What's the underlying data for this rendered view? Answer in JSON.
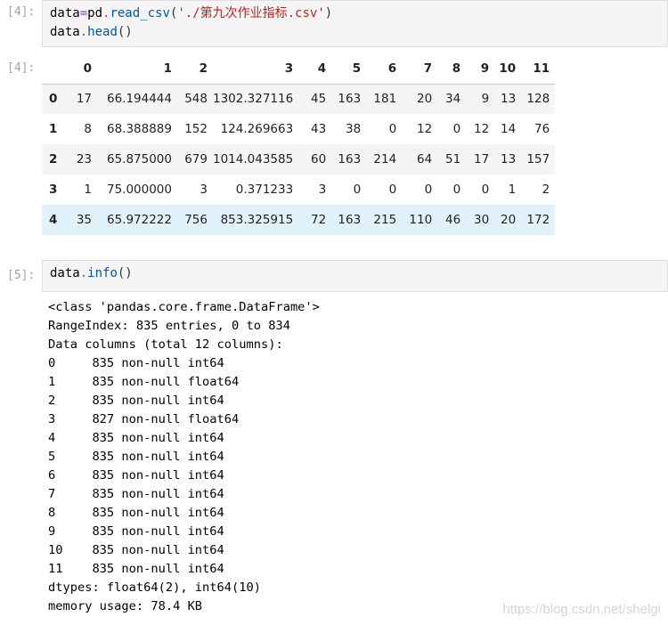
{
  "cells": [
    {
      "prompt": "[4]:",
      "code": [
        [
          {
            "t": "data",
            "c": "tok-var"
          },
          {
            "t": "=",
            "c": "tok-op"
          },
          {
            "t": "pd",
            "c": "tok-var"
          },
          {
            "t": ".",
            "c": "tok-op"
          },
          {
            "t": "read_csv",
            "c": "tok-attr"
          },
          {
            "t": "(",
            "c": "tok-paren"
          },
          {
            "t": "'./第九次作业指标.csv'",
            "c": "tok-str"
          },
          {
            "t": ")",
            "c": "tok-paren"
          }
        ],
        [
          {
            "t": "data",
            "c": "tok-var"
          },
          {
            "t": ".",
            "c": "tok-op"
          },
          {
            "t": "head",
            "c": "tok-attr"
          },
          {
            "t": "()",
            "c": "tok-paren"
          }
        ]
      ]
    },
    {
      "prompt": "[5]:",
      "code": [
        [
          {
            "t": "data",
            "c": "tok-var"
          },
          {
            "t": ".",
            "c": "tok-op"
          },
          {
            "t": "info",
            "c": "tok-attr"
          },
          {
            "t": "()",
            "c": "tok-paren"
          }
        ]
      ]
    }
  ],
  "out_prompt": "[4]:",
  "table": {
    "columns": [
      "0",
      "1",
      "2",
      "3",
      "4",
      "5",
      "6",
      "7",
      "8",
      "9",
      "10",
      "11"
    ],
    "rows": [
      {
        "index": "0",
        "values": [
          "17",
          "66.194444",
          "548",
          "1302.327116",
          "45",
          "163",
          "181",
          "20",
          "34",
          "9",
          "13",
          "128"
        ]
      },
      {
        "index": "1",
        "values": [
          "8",
          "68.388889",
          "152",
          "124.269663",
          "43",
          "38",
          "0",
          "12",
          "0",
          "12",
          "14",
          "76"
        ]
      },
      {
        "index": "2",
        "values": [
          "23",
          "65.875000",
          "679",
          "1014.043585",
          "60",
          "163",
          "214",
          "64",
          "51",
          "17",
          "13",
          "157"
        ]
      },
      {
        "index": "3",
        "values": [
          "1",
          "75.000000",
          "3",
          "0.371233",
          "3",
          "0",
          "0",
          "0",
          "0",
          "0",
          "1",
          "2"
        ]
      },
      {
        "index": "4",
        "values": [
          "35",
          "65.972222",
          "756",
          "853.325915",
          "72",
          "163",
          "215",
          "110",
          "46",
          "30",
          "20",
          "172"
        ]
      }
    ],
    "hover_row": 4
  },
  "info_output": [
    "<class 'pandas.core.frame.DataFrame'>",
    "RangeIndex: 835 entries, 0 to 834",
    "Data columns (total 12 columns):",
    "0     835 non-null int64",
    "1     835 non-null float64",
    "2     835 non-null int64",
    "3     827 non-null float64",
    "4     835 non-null int64",
    "5     835 non-null int64",
    "6     835 non-null int64",
    "7     835 non-null int64",
    "8     835 non-null int64",
    "9     835 non-null int64",
    "10    835 non-null int64",
    "11    835 non-null int64",
    "dtypes: float64(2), int64(10)",
    "memory usage: 78.4 KB"
  ],
  "watermark": "https://blog.csdn.net/shelgi"
}
